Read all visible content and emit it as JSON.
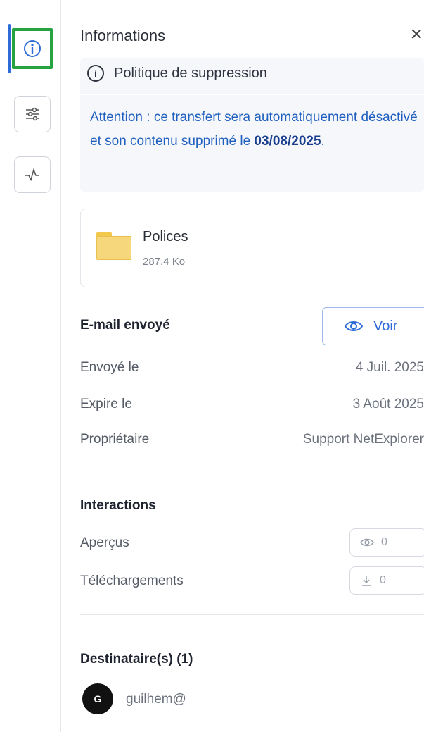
{
  "rail": {
    "items": [
      {
        "icon": "info-icon",
        "active": true
      },
      {
        "icon": "sliders-icon",
        "active": false
      },
      {
        "icon": "activity-icon",
        "active": false
      }
    ]
  },
  "panel": {
    "title": "Informations",
    "close_glyph": "×"
  },
  "notice": {
    "heading": "Politique de suppression",
    "body_prefix": "Attention : ce transfert sera automatiquement désactivé et son contenu supprimé le ",
    "date": "03/08/2025",
    "body_suffix": "."
  },
  "file": {
    "name": "Polices",
    "size": "287.4 Ko"
  },
  "email": {
    "section_title": "E-mail envoyé",
    "view_label": "Voir",
    "rows": [
      {
        "label": "Envoyé le",
        "value": "4 Juil. 2025"
      },
      {
        "label": "Expire le",
        "value": "3 Août 2025"
      },
      {
        "label": "Propriétaire",
        "value": "Support NetExplorer"
      }
    ]
  },
  "interactions": {
    "section_title": "Interactions",
    "rows": [
      {
        "label": "Aperçus",
        "value": "0",
        "icon": "eye-icon"
      },
      {
        "label": "Téléchargements",
        "value": "0",
        "icon": "download-icon"
      }
    ]
  },
  "recipients": {
    "section_title": "Destinataire(s) (1)",
    "items": [
      {
        "initial": "G",
        "email": "guilhem@"
      }
    ]
  },
  "colors": {
    "accent": "#2f6bd8",
    "active_outline": "#27a243",
    "notice_text": "#1f5fbf"
  }
}
